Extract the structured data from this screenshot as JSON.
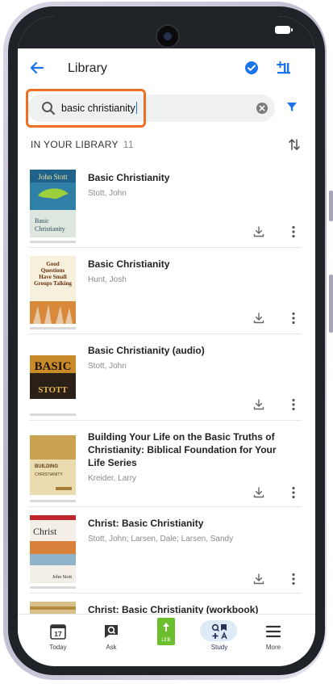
{
  "header": {
    "title": "Library"
  },
  "search": {
    "query": "basic christianity"
  },
  "library": {
    "heading": "IN YOUR LIBRARY",
    "count": "11"
  },
  "books": [
    {
      "title": "Basic Christianity",
      "author": "Stott, John",
      "cover_text": "John Stott",
      "cover_sub": "Basic Christianity"
    },
    {
      "title": "Basic Christianity",
      "author": "Hunt, Josh",
      "cover_text": "Good Questions Have Small Groups Talking",
      "cover_sub": "Basic Christianity"
    },
    {
      "title": "Basic Christianity (audio)",
      "author": "Stott, John",
      "cover_text": "BASIC",
      "cover_sub": "STOTT"
    },
    {
      "title": "Building Your Life on the Basic Truths of Christianity: Biblical Foundation for Your Life Series",
      "author": "Kreider, Larry",
      "cover_text": "BUILDING",
      "cover_sub": "CHRISTIANITY"
    },
    {
      "title": "Christ: Basic Christianity",
      "author": "Stott, John; Larsen, Dale; Larsen, Sandy",
      "cover_text": "Christ",
      "cover_sub": "John Stott"
    },
    {
      "title": "Christ: Basic Christianity (workbook)",
      "author": "",
      "cover_text": "",
      "cover_sub": ""
    }
  ],
  "nav": {
    "today_label": "Today",
    "today_day": "17",
    "ask_label": "Ask",
    "leb_label": "LEB",
    "study_label": "Study",
    "more_label": "More"
  },
  "colors": {
    "accent": "#1a73e8",
    "highlight": "#ee6f23",
    "study_bg": "#dfeaf7",
    "leb_green": "#6cbf2c"
  }
}
